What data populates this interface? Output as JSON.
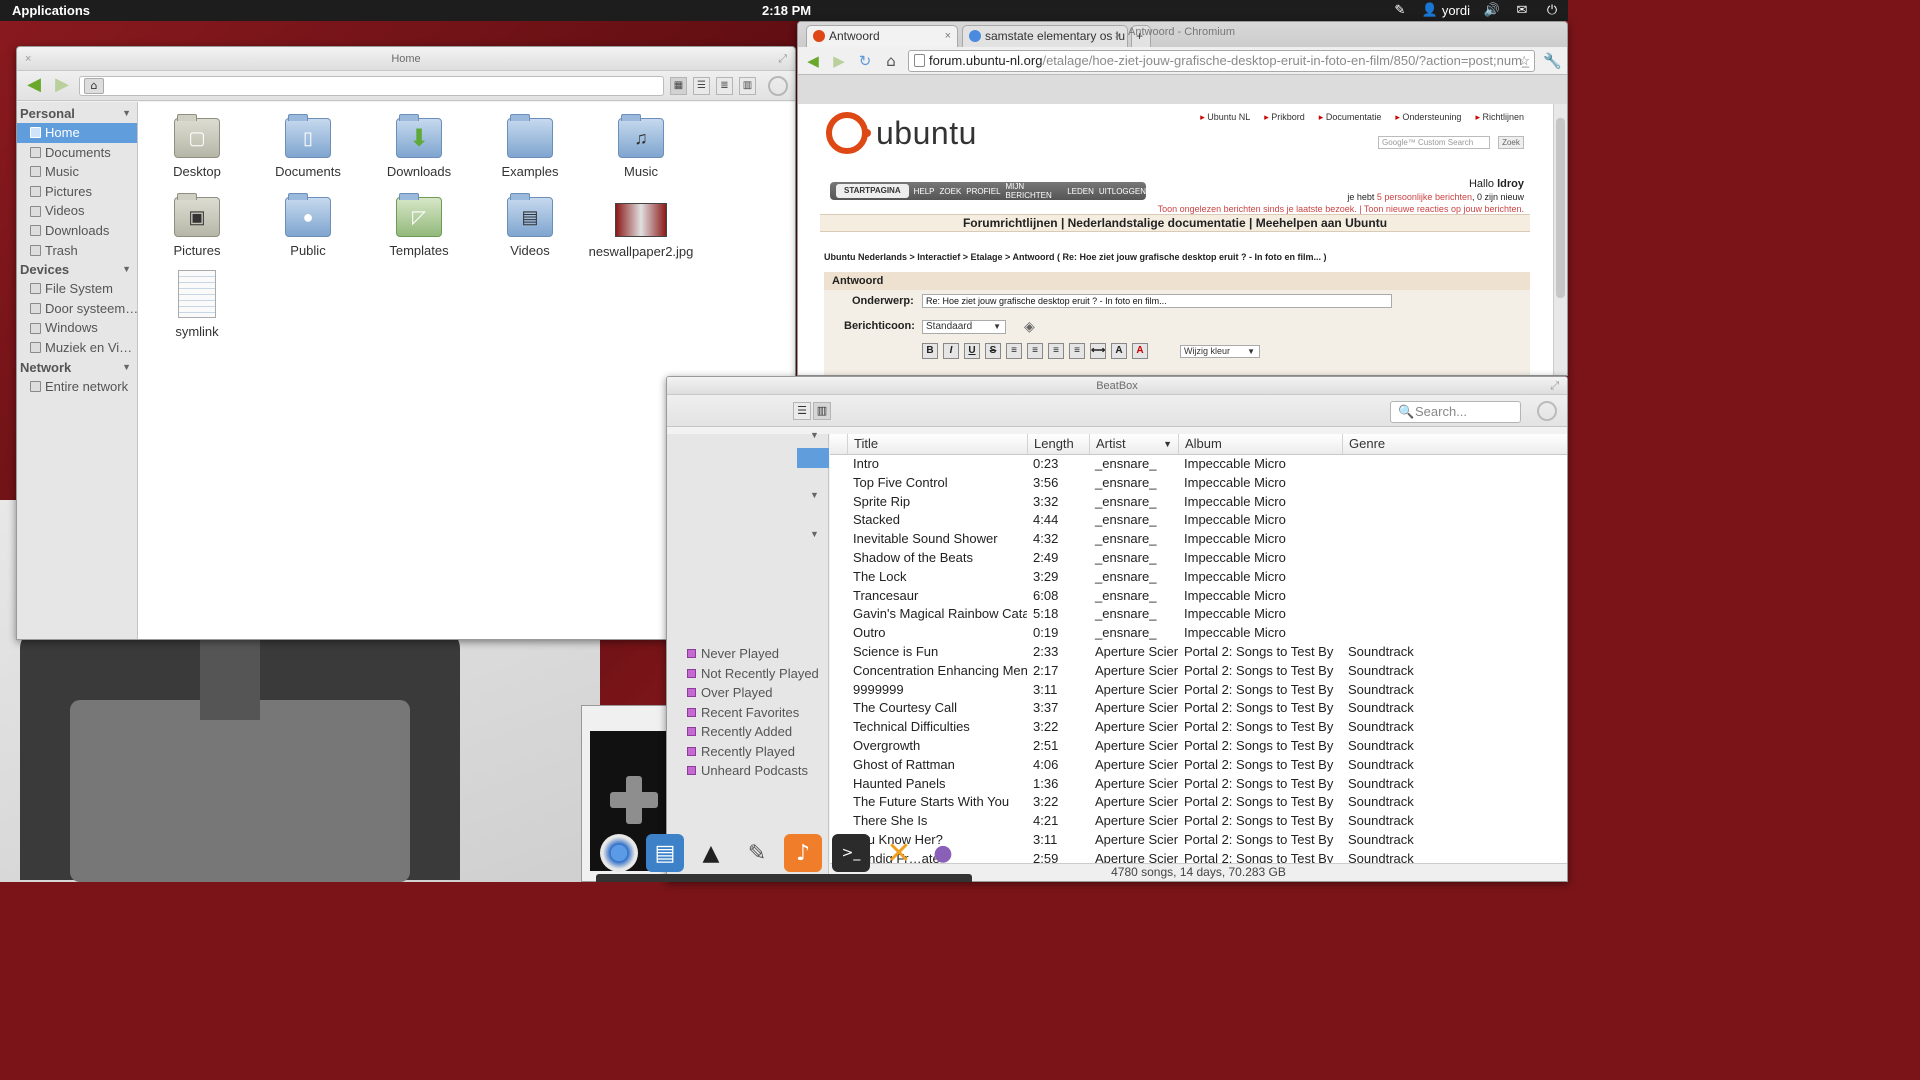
{
  "top_panel": {
    "applications": "Applications",
    "clock": "2:18 PM",
    "user": "yordi"
  },
  "files": {
    "title": "Home",
    "sidebar": {
      "personal_head": "Personal",
      "personal": [
        "Home",
        "Documents",
        "Music",
        "Pictures",
        "Videos",
        "Downloads",
        "Trash"
      ],
      "devices_head": "Devices",
      "devices": [
        "File System",
        "Door systeem…",
        "Windows",
        "Muziek en Vi…"
      ],
      "network_head": "Network",
      "network": [
        "Entire network"
      ]
    },
    "items": [
      "Desktop",
      "Documents",
      "Downloads",
      "Examples",
      "Music",
      "Pictures",
      "Public",
      "Templates",
      "Videos",
      "neswallpaper2.jpg",
      "symlink"
    ]
  },
  "chromium": {
    "title": "Antwoord - Chromium",
    "tabs": [
      "Antwoord",
      "samstate elementary os lu"
    ],
    "url_host": "forum.ubuntu-nl.org",
    "url_path": "/etalage/hoe-ziet-jouw-grafische-desktop-eruit-in-foto-en-film/850/?action=post;num_",
    "page": {
      "logo": "ubuntu",
      "topnav": [
        "Ubuntu NL",
        "Prikbord",
        "Documentatie",
        "Ondersteuning",
        "Richtlijnen"
      ],
      "search_placeholder": "Google™ Custom Search",
      "search_button": "Zoek",
      "menu": [
        "STARTPAGINA",
        "HELP",
        "ZOEK",
        "PROFIEL",
        "MIJN BERICHTEN",
        "LEDEN",
        "UITLOGGEN"
      ],
      "hallo": "Hallo",
      "user": "ldroy",
      "info_pre": "je hebt",
      "info_link": "5 persoonlijke berichten",
      "info_post": ", 0 zijn nieuw",
      "info2": "Toon ongelezen berichten sinds je laatste bezoek. | Toon nieuwe reacties op jouw berichten.",
      "links_bar": "Forumrichtlijnen | Nederlandstalige documentatie | Meehelpen aan Ubuntu",
      "breadcrumb": "Ubuntu Nederlands > Interactief > Etalage > Antwoord ( Re: Hoe ziet jouw grafische desktop eruit ? - In foto en film... )",
      "section": "Antwoord",
      "subject_label": "Onderwerp:",
      "subject_value": "Re: Hoe ziet jouw grafische desktop eruit ? - In foto en film...",
      "icon_label": "Berichticoon:",
      "icon_value": "Standaard",
      "color_select": "Wijzig kleur"
    }
  },
  "beatbox": {
    "title": "BeatBox",
    "search_placeholder": "Search...",
    "smart_playlists": [
      "Never Played",
      "Not Recently Played",
      "Over Played",
      "Recent Favorites",
      "Recently Added",
      "Recently Played",
      "Unheard Podcasts"
    ],
    "columns": [
      "Title",
      "Length",
      "Artist",
      "Album",
      "Genre"
    ],
    "rows": [
      [
        "Intro",
        "0:23",
        "_ensnare_",
        "Impeccable Micro",
        ""
      ],
      [
        "Top Five Control",
        "3:56",
        "_ensnare_",
        "Impeccable Micro",
        ""
      ],
      [
        "Sprite Rip",
        "3:32",
        "_ensnare_",
        "Impeccable Micro",
        ""
      ],
      [
        "Stacked",
        "4:44",
        "_ensnare_",
        "Impeccable Micro",
        ""
      ],
      [
        "Inevitable Sound Shower",
        "4:32",
        "_ensnare_",
        "Impeccable Micro",
        ""
      ],
      [
        "Shadow of the Beats",
        "2:49",
        "_ensnare_",
        "Impeccable Micro",
        ""
      ],
      [
        "The Lock",
        "3:29",
        "_ensnare_",
        "Impeccable Micro",
        ""
      ],
      [
        "Trancesaur",
        "6:08",
        "_ensnare_",
        "Impeccable Micro",
        ""
      ],
      [
        "Gavin's Magical Rainbow Catast",
        "5:18",
        "_ensnare_",
        "Impeccable Micro",
        ""
      ],
      [
        "Outro",
        "0:19",
        "_ensnare_",
        "Impeccable Micro",
        ""
      ],
      [
        "Science is Fun",
        "2:33",
        "Aperture Scien",
        "Portal 2: Songs to Test By",
        "Soundtrack"
      ],
      [
        "Concentration Enhancing Menu",
        "2:17",
        "Aperture Scien",
        "Portal 2: Songs to Test By",
        "Soundtrack"
      ],
      [
        "9999999",
        "3:11",
        "Aperture Scien",
        "Portal 2: Songs to Test By",
        "Soundtrack"
      ],
      [
        "The Courtesy Call",
        "3:37",
        "Aperture Scien",
        "Portal 2: Songs to Test By",
        "Soundtrack"
      ],
      [
        "Technical Difficulties",
        "3:22",
        "Aperture Scien",
        "Portal 2: Songs to Test By",
        "Soundtrack"
      ],
      [
        "Overgrowth",
        "2:51",
        "Aperture Scien",
        "Portal 2: Songs to Test By",
        "Soundtrack"
      ],
      [
        "Ghost of Rattman",
        "4:06",
        "Aperture Scien",
        "Portal 2: Songs to Test By",
        "Soundtrack"
      ],
      [
        "Haunted Panels",
        "1:36",
        "Aperture Scien",
        "Portal 2: Songs to Test By",
        "Soundtrack"
      ],
      [
        "The Future Starts With You",
        "3:22",
        "Aperture Scien",
        "Portal 2: Songs to Test By",
        "Soundtrack"
      ],
      [
        "There She Is",
        "4:21",
        "Aperture Scien",
        "Portal 2: Songs to Test By",
        "Soundtrack"
      ],
      [
        "You Know Her?",
        "3:11",
        "Aperture Scien",
        "Portal 2: Songs to Test By",
        "Soundtrack"
      ],
      [
        "Fendig Fr…ate",
        "2:59",
        "Aperture Scien",
        "Portal 2: Songs to Test By",
        "Soundtrack"
      ]
    ],
    "status": "4780 songs, 14 days, 70.283 GB"
  },
  "dock": [
    "chromium-icon",
    "files-icon",
    "inkscape-icon",
    "gimp-icon",
    "beatbox-icon",
    "terminal-icon",
    "tools-icon",
    "pidgin-icon"
  ]
}
